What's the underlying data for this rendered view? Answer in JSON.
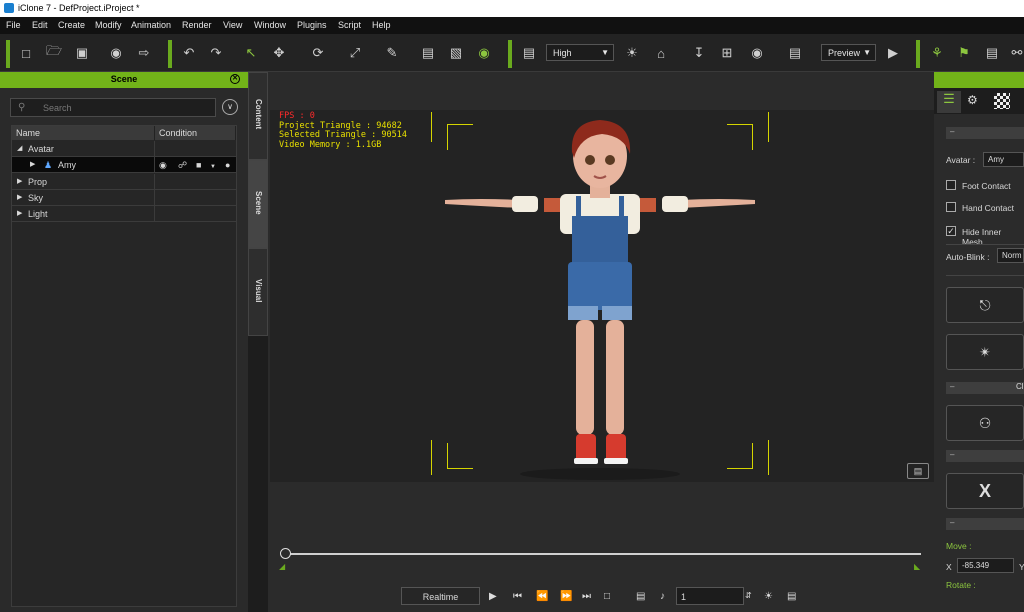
{
  "window": {
    "title": "iClone 7 - DefProject.iProject *"
  },
  "menu": [
    "File",
    "Edit",
    "Create",
    "Modify",
    "Animation",
    "Render",
    "View",
    "Window",
    "Plugins",
    "Script",
    "Help"
  ],
  "toolbar": {
    "quality_value": "High",
    "preview_value": "Preview",
    "icons": [
      "new-file-icon",
      "open-folder-icon",
      "save-icon",
      "preview-eye-icon",
      "export-icon",
      "undo-icon",
      "redo-icon",
      "select-arrow-icon",
      "move-icon",
      "rotate-icon",
      "scale-icon",
      "pick-icon",
      "align-icon",
      "align-bottom-icon",
      "visibility-eye-icon",
      "layout-icon",
      "light-bulb-icon",
      "home-icon",
      "drop-to-floor-icon",
      "snap-icon",
      "camera-icon",
      "stack-icon",
      "video-camera-icon",
      "motion-icon",
      "flag-icon",
      "clipboard-icon",
      "key-icon"
    ]
  },
  "scene": {
    "header": "Scene",
    "search_placeholder": "Search",
    "columns": [
      "Name",
      "Condition"
    ],
    "rows": [
      {
        "label": "Avatar",
        "expanded": true
      },
      {
        "label": "Amy",
        "selected": true
      },
      {
        "label": "Prop"
      },
      {
        "label": "Sky"
      },
      {
        "label": "Light"
      }
    ]
  },
  "side_tabs": [
    "Content",
    "Scene",
    "Visual"
  ],
  "viewport": {
    "fps_label": "FPS : 0",
    "stats": [
      "Project Triangle : 94682",
      "Selected Triangle : 90514",
      "Video Memory : 1.1GB"
    ]
  },
  "playback": {
    "mode": "Realtime",
    "frame": "1"
  },
  "right_panel": {
    "avatar_label": "Avatar :",
    "avatar_value": "Amy",
    "foot_contact": "Foot Contact",
    "hand_contact": "Hand Contact",
    "hide_inner_mesh": "Hide Inner Mesh",
    "hide_inner_mesh_checked": true,
    "auto_blink_label": "Auto-Blink :",
    "auto_blink_value": "Norm",
    "section_c": "Cl",
    "move_label": "Move :",
    "x_label": "X",
    "x_value": "-85.349",
    "y_label": "Y",
    "rotate_label": "Rotate :"
  },
  "colors": {
    "accent": "#72b319",
    "stats_text": "#e8e000",
    "fps_text": "#ff2a2a"
  }
}
